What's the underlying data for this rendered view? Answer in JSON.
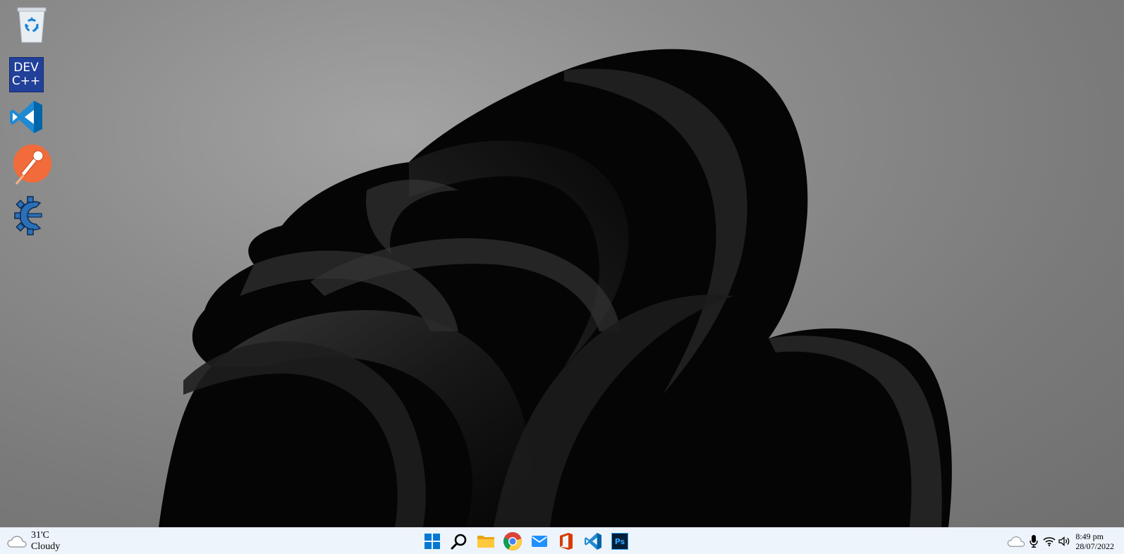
{
  "desktop": {
    "icons": [
      {
        "name": "Recycle Bin",
        "icon": "recycle-bin-icon"
      },
      {
        "name": "Dev-C++",
        "icon": "dev-cpp-icon",
        "line1": "DEV",
        "line2": "C++"
      },
      {
        "name": "Visual Studio Code",
        "icon": "vscode-icon"
      },
      {
        "name": "Postman",
        "icon": "postman-icon"
      },
      {
        "name": "Cheat Engine",
        "icon": "cheat-engine-icon"
      }
    ]
  },
  "taskbar": {
    "weather": {
      "temperature": "31'C",
      "condition": "Cloudy",
      "icon": "cloud-icon"
    },
    "apps": [
      {
        "name": "Start",
        "icon": "windows-start-icon"
      },
      {
        "name": "Search",
        "icon": "search-icon"
      },
      {
        "name": "File Explorer",
        "icon": "folder-icon"
      },
      {
        "name": "Google Chrome",
        "icon": "chrome-icon"
      },
      {
        "name": "Mail",
        "icon": "mail-icon"
      },
      {
        "name": "Microsoft Office",
        "icon": "office-icon"
      },
      {
        "name": "Visual Studio Code",
        "icon": "vscode-icon"
      },
      {
        "name": "Adobe Photoshop",
        "icon": "photoshop-icon",
        "label": "Ps"
      }
    ],
    "tray": {
      "icons": [
        "cloud-icon",
        "microphone-icon",
        "wifi-icon",
        "speaker-icon"
      ],
      "time": "8:49 pm",
      "date": "28/07/2022"
    }
  },
  "colors": {
    "taskbar_bg": "#eef4fb",
    "windows_blue": "#0078d4",
    "vscode_blue": "#0a7acc",
    "postman_orange": "#f26b3a",
    "devcpp_blue": "#21409a",
    "office_red": "#d83b01",
    "photoshop_bg": "#001e36",
    "photoshop_text": "#31a8ff"
  }
}
